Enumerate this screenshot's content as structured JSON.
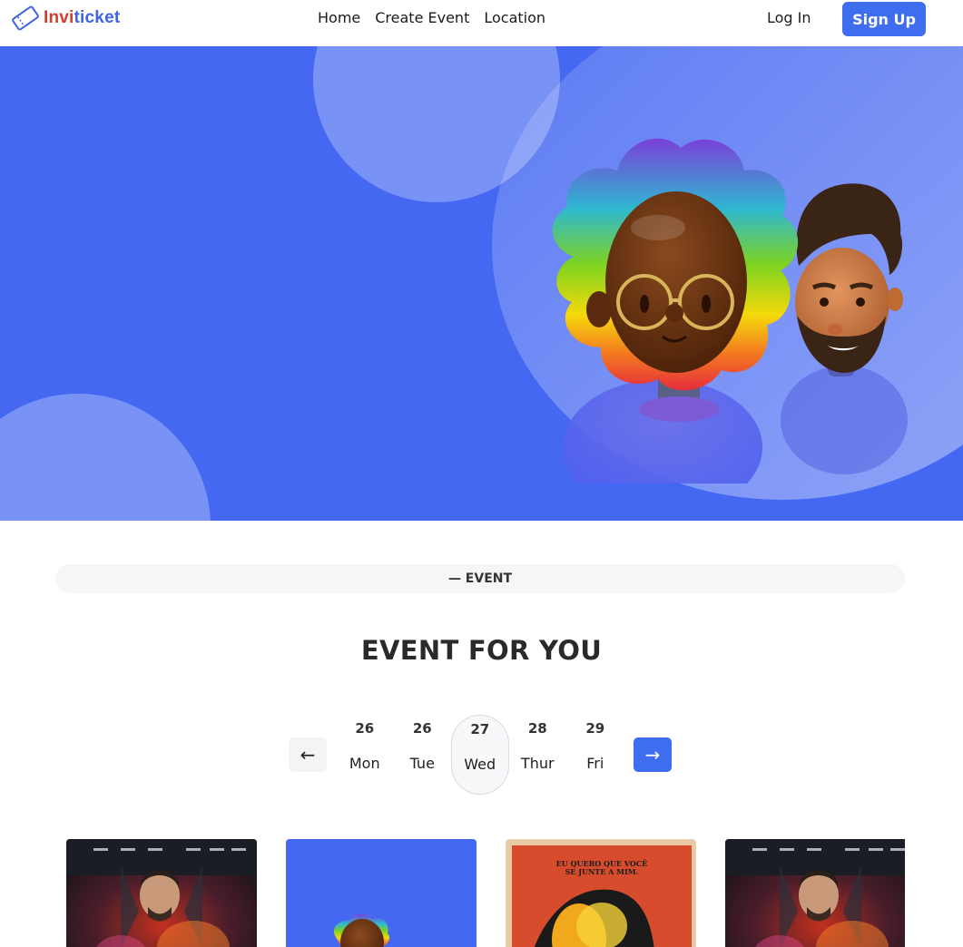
{
  "brand": {
    "name_part1": "Invi",
    "name_part2": "ticket"
  },
  "nav": [
    "Home",
    "Create Event",
    "Location"
  ],
  "auth": {
    "login": "Log In",
    "signup": "Sign Up"
  },
  "section": {
    "label": "— EVENT",
    "title": "EVENT FOR YOU"
  },
  "date_picker": {
    "prev": "←",
    "next": "→",
    "selected": "Wed",
    "days": [
      {
        "num": "26",
        "name": "Mon"
      },
      {
        "num": "26",
        "name": "Tue"
      },
      {
        "num": "27",
        "name": "Wed"
      },
      {
        "num": "28",
        "name": "Thur"
      },
      {
        "num": "29",
        "name": "Fri"
      }
    ]
  },
  "cards": [
    {
      "image": "movie-poster-doctor-strange"
    },
    {
      "image": "3d-avatar-illustration"
    },
    {
      "image": "movie-poster-retro"
    },
    {
      "image": "movie-poster-doctor-strange"
    }
  ],
  "colors": {
    "accent": "#3f6df0",
    "hero": "#4568f2",
    "logo_red": "#d63b2f",
    "logo_blue": "#3d64e8"
  }
}
